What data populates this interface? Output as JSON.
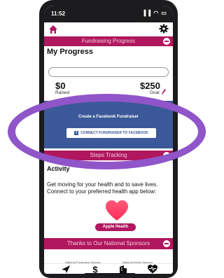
{
  "status_bar": {
    "time": "11:52",
    "icons": "▐▐ ◠ ▭"
  },
  "fundraising_section": {
    "title": "Fundraising Progress"
  },
  "progress": {
    "heading": "My Progress",
    "raised_amount": "$0",
    "raised_label": "Raised",
    "goal_amount": "$250",
    "goal_label": "Goal",
    "fraction": 0
  },
  "facebook": {
    "title": "Create a Facebook Fundraiser",
    "button_label": "CONNECT FUNDRAISER TO FACEBOOK",
    "logo_letter": "f"
  },
  "steps_section": {
    "title": "Steps Tracking",
    "heading": "Activity",
    "description": "Get moving for your health and to save lives. Connect to your preferred health app below:",
    "apple_health_label": "Apple Health"
  },
  "sponsors_section": {
    "title": "Thanks to Our National Sponsors",
    "left_caption": "National Presenting Sponsor",
    "right_caption": "National Series Sponsor"
  },
  "tab_bar": {
    "tabs": [
      "send-icon",
      "dollar-icon",
      "building-icon",
      "heart-pulse-icon"
    ]
  },
  "colors": {
    "accent": "#b0175e",
    "facebook": "#3b5998",
    "highlight_ellipse": "#8f55c9"
  }
}
